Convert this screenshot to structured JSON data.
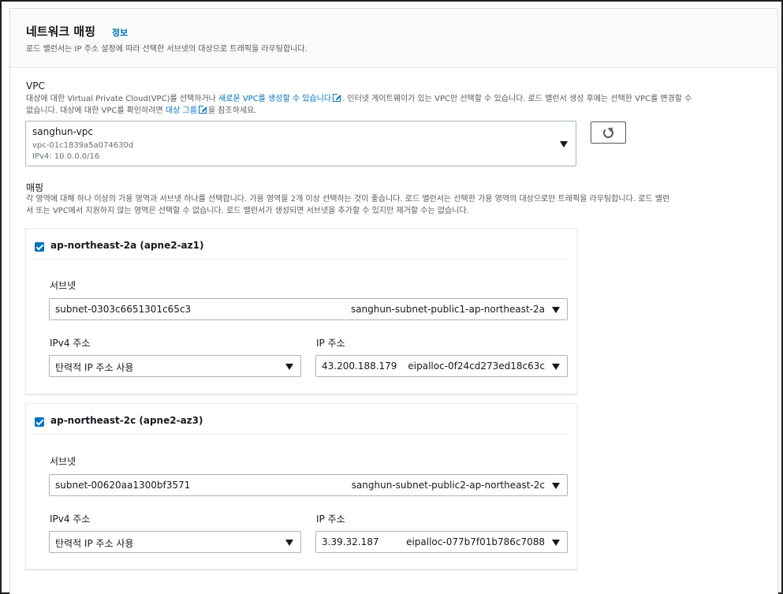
{
  "section": {
    "title": "네트워크 매핑",
    "info_link": "정보",
    "subtitle": "로드 밸런서는 IP 주소 설정에 따라 선택한 서브넷의 대상으로 트래픽을 라우팅합니다."
  },
  "vpc": {
    "label": "VPC",
    "desc_part1": "대상에 대한 Virtual Private Cloud(VPC)를 선택하거나 ",
    "desc_link1": "새로운 VPC를 생성할 수 있습니다",
    "desc_part2": ". 인터넷 게이트웨이가 있는 VPC만 선택할 수 있습니다. 로드 밸런서 생성 후에는 선택한 VPC를 변경할 수",
    "desc_part3": "없습니다. 대상에 대한 VPC를 확인하려면 ",
    "desc_link2": "대상 그룹",
    "desc_part4": "을 참조하세요.",
    "selected_name": "sanghun-vpc",
    "selected_id": "vpc-01c1839a5a074630d",
    "selected_cidr": "IPv4: 10.0.0.0/16"
  },
  "mapping": {
    "label": "매핑",
    "desc_line1": "각 영역에 대해 하나 이상의 가용 영역과 서브넷 하나를 선택합니다. 가용 영역을 2개 이상 선택하는 것이 좋습니다. 로드 밸런서는 선택한 가용 영역의 대상으로만 트래픽을 라우팅합니다. 로드 밸런",
    "desc_line2": "서 또는 VPC에서 지원하지 않는 영역은 선택할 수 없습니다. 로드 밸런서가 생성되면 서브넷을 추가할 수 있지만 제거할 수는 없습니다."
  },
  "zones": [
    {
      "title": "ap-northeast-2a (apne2-az1)",
      "subnet_label": "서브넷",
      "subnet_id": "subnet-0303c6651301c65c3",
      "subnet_name": "sanghun-subnet-public1-ap-northeast-2a",
      "ipv4_label": "IPv4 주소",
      "ipv4_value": "탄력적 IP 주소 사용",
      "ip_label": "IP 주소",
      "ip_value": "43.200.188.179",
      "eip_value": "eipalloc-0f24cd273ed18c63c"
    },
    {
      "title": "ap-northeast-2c (apne2-az3)",
      "subnet_label": "서브넷",
      "subnet_id": "subnet-00620aa1300bf3571",
      "subnet_name": "sanghun-subnet-public2-ap-northeast-2c",
      "ipv4_label": "IPv4 주소",
      "ipv4_value": "탄력적 IP 주소 사용",
      "ip_label": "IP 주소",
      "ip_value": "3.39.32.187",
      "eip_value": "eipalloc-077b7f01b786c7088"
    }
  ],
  "colors": {
    "link": "#0073bb",
    "checkbox": "#0073bb",
    "text": "#16191f",
    "muted": "#545b64"
  }
}
